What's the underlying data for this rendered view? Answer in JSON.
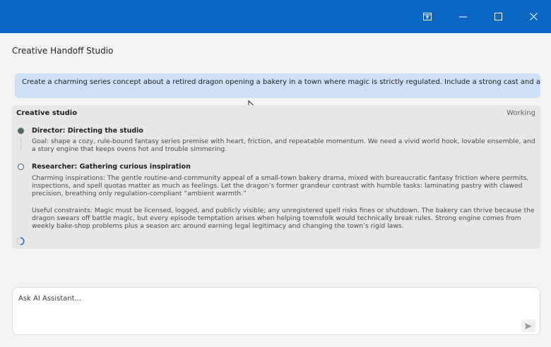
{
  "window": {
    "title": "Creative Handoff Studio",
    "controls": [
      "pin-icon",
      "minimize-icon",
      "maximize-icon",
      "close-icon"
    ],
    "titlebar_color": "#0a67c3"
  },
  "prompt": {
    "text": "Create a charming series concept about a retired dragon opening a bakery in a town where magic is strictly regulated. Include a strong cast and an ongoing story engine."
  },
  "studio": {
    "title": "Creative studio",
    "status": "Working",
    "steps": [
      {
        "title": "Director: Directing the studio",
        "state": "done",
        "body": "Goal: shape a cozy, rule-bound fantasy series premise with heart, friction, and repeatable momentum. We need a vivid world hook, lovable ensemble, and a story engine that keeps ovens hot and trouble simmering."
      },
      {
        "title": "Researcher: Gathering curious inspiration",
        "state": "active",
        "body_1": "Charming inspirations: The gentle routine-and-community appeal of a small-town bakery drama, mixed with bureaucratic fantasy friction where permits, inspections, and spell quotas matter as much as feelings. Let the dragon’s former grandeur contrast with humble tasks: laminating pastry with clawed precision, breathing only regulation-compliant “ambient warmth.”",
        "body_2": "Useful constraints: Magic must be licensed, logged, and publicly visible; any unregistered spell risks fines or shutdown. The bakery can thrive because the dragon swears off battle magic, but every episode temptation arises when helping townsfolk would technically break rules. Strong engine comes from weekly bake-shop problems plus a season arc around earning legal legitimacy and changing the town’s rigid laws."
      }
    ]
  },
  "composer": {
    "placeholder": "Ask AI Assistant...",
    "send_icon": "send-icon"
  }
}
